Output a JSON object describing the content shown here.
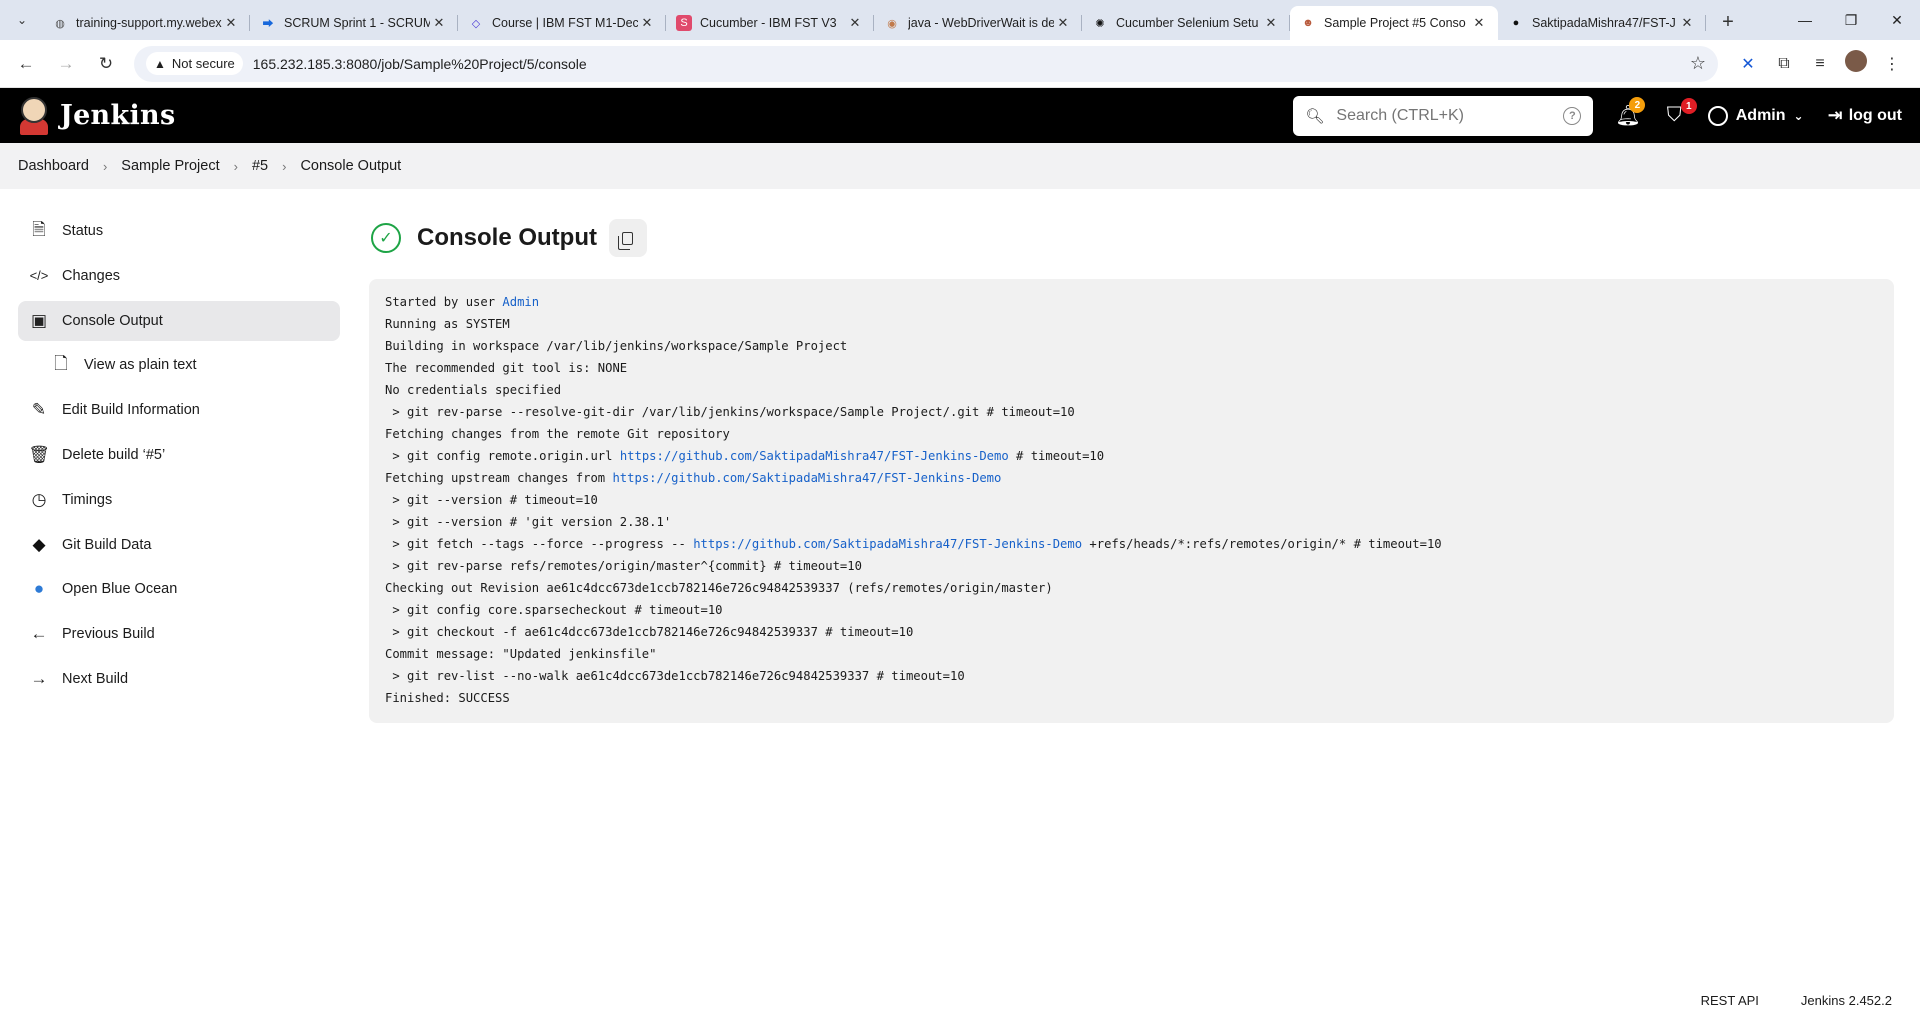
{
  "browser": {
    "tabs": [
      {
        "title": "training-support.my.webex",
        "favicon": "globe-icon",
        "active": false
      },
      {
        "title": "SCRUM Sprint 1 - SCRUM",
        "favicon": "jira-icon",
        "active": false
      },
      {
        "title": "Course | IBM FST M1-Dec",
        "favicon": "course-icon",
        "active": false
      },
      {
        "title": "Cucumber - IBM FST V3",
        "favicon": "s-icon",
        "active": false
      },
      {
        "title": "java - WebDriverWait is de",
        "favicon": "stackoverflow-icon",
        "active": false
      },
      {
        "title": "Cucumber Selenium Setu",
        "favicon": "chatgpt-icon",
        "active": false
      },
      {
        "title": "Sample Project #5 Conso",
        "favicon": "jenkins-icon",
        "active": true
      },
      {
        "title": "SaktipadaMishra47/FST-J",
        "favicon": "github-icon",
        "active": false
      }
    ],
    "not_secure_label": "Not secure",
    "url": "165.232.185.3:8080/job/Sample%20Project/5/console"
  },
  "header": {
    "app_name": "Jenkins",
    "search_placeholder": "Search (CTRL+K)",
    "notifications_count": "2",
    "security_count": "1",
    "user_name": "Admin",
    "logout_label": "log out"
  },
  "breadcrumb": [
    "Dashboard",
    "Sample Project",
    "#5",
    "Console Output"
  ],
  "sidebar": {
    "items": [
      {
        "label": "Status",
        "icon": "document-icon"
      },
      {
        "label": "Changes",
        "icon": "code-icon"
      },
      {
        "label": "Console Output",
        "icon": "terminal-icon"
      },
      {
        "label": "View as plain text",
        "icon": "file-icon"
      },
      {
        "label": "Edit Build Information",
        "icon": "edit-icon"
      },
      {
        "label": "Delete build ‘#5’",
        "icon": "trash-icon"
      },
      {
        "label": "Timings",
        "icon": "clock-icon"
      },
      {
        "label": "Git Build Data",
        "icon": "git-icon"
      },
      {
        "label": "Open Blue Ocean",
        "icon": "blue-ocean-icon"
      },
      {
        "label": "Previous Build",
        "icon": "arrow-left-icon"
      },
      {
        "label": "Next Build",
        "icon": "arrow-right-icon"
      }
    ]
  },
  "main": {
    "title": "Console Output",
    "console_lines": [
      [
        "Started by user ",
        {
          "link": "Admin"
        }
      ],
      [
        "Running as SYSTEM"
      ],
      [
        "Building in workspace /var/lib/jenkins/workspace/Sample Project"
      ],
      [
        "The recommended git tool is: NONE"
      ],
      [
        "No credentials specified"
      ],
      [
        " > git rev-parse --resolve-git-dir /var/lib/jenkins/workspace/Sample Project/.git # timeout=10"
      ],
      [
        "Fetching changes from the remote Git repository"
      ],
      [
        " > git config remote.origin.url ",
        {
          "link": "https://github.com/SaktipadaMishra47/FST-Jenkins-Demo"
        },
        " # timeout=10"
      ],
      [
        "Fetching upstream changes from ",
        {
          "link": "https://github.com/SaktipadaMishra47/FST-Jenkins-Demo"
        }
      ],
      [
        " > git --version # timeout=10"
      ],
      [
        " > git --version # 'git version 2.38.1'"
      ],
      [
        " > git fetch --tags --force --progress -- ",
        {
          "link": "https://github.com/SaktipadaMishra47/FST-Jenkins-Demo"
        },
        " +refs/heads/*:refs/remotes/origin/* # timeout=10"
      ],
      [
        " > git rev-parse refs/remotes/origin/master^{commit} # timeout=10"
      ],
      [
        "Checking out Revision ae61c4dcc673de1ccb782146e726c94842539337 (refs/remotes/origin/master)"
      ],
      [
        " > git config core.sparsecheckout # timeout=10"
      ],
      [
        " > git checkout -f ae61c4dcc673de1ccb782146e726c94842539337 # timeout=10"
      ],
      [
        "Commit message: \"Updated jenkinsfile\""
      ],
      [
        " > git rev-list --no-walk ae61c4dcc673de1ccb782146e726c94842539337 # timeout=10"
      ],
      [
        "Finished: SUCCESS"
      ]
    ]
  },
  "footer": {
    "rest_api": "REST API",
    "version": "Jenkins 2.452.2"
  },
  "colors": {
    "success": "#1ea446",
    "link": "#1761c9",
    "header_bg": "#000000",
    "badge_orange": "#f59e0b",
    "badge_red": "#e01e25"
  }
}
